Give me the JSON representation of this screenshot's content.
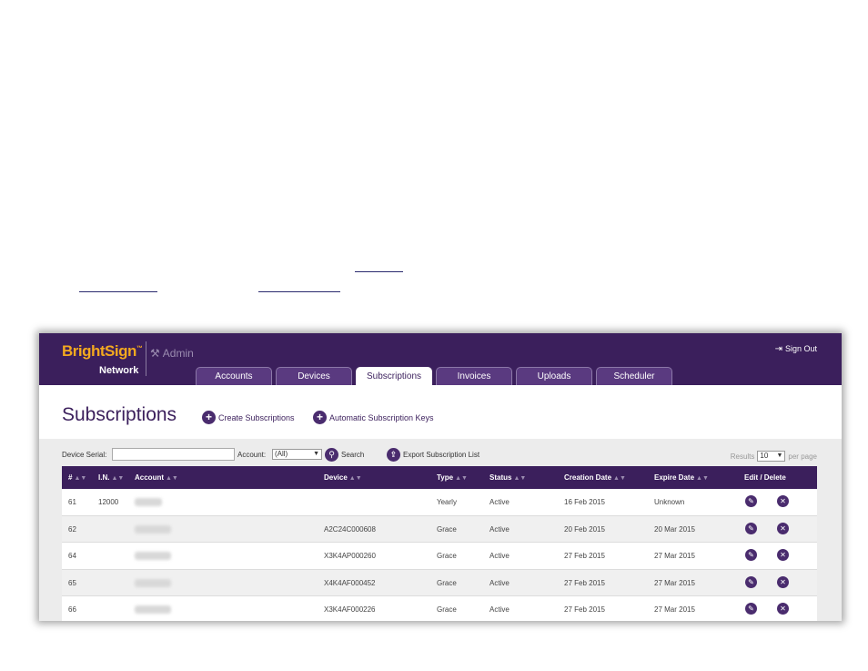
{
  "header": {
    "brand": "BrightSign",
    "brand_sub": "Network",
    "admin_label": "Admin",
    "signout_label": "Sign Out",
    "tabs": [
      {
        "label": "Accounts",
        "active": false
      },
      {
        "label": "Devices",
        "active": false
      },
      {
        "label": "Subscriptions",
        "active": true
      },
      {
        "label": "Invoices",
        "active": false
      },
      {
        "label": "Uploads",
        "active": false
      },
      {
        "label": "Scheduler",
        "active": false
      }
    ]
  },
  "page": {
    "title": "Subscriptions",
    "create_label": "Create Subscriptions",
    "auto_keys_label": "Automatic Subscription Keys"
  },
  "filter": {
    "device_serial_label": "Device Serial:",
    "device_serial_value": "",
    "account_label": "Account:",
    "account_value": "(All)",
    "search_label": "Search",
    "export_label": "Export Subscription List",
    "results_label": "Results",
    "results_value": "10",
    "per_page_label": "per page"
  },
  "table": {
    "columns": [
      "#",
      "I.N.",
      "Account",
      "Device",
      "Type",
      "Status",
      "Creation Date",
      "Expire Date",
      "Edit / Delete"
    ],
    "rows": [
      {
        "num": "61",
        "in": "12000",
        "device": "",
        "type": "Yearly",
        "status": "Active",
        "created": "16 Feb 2015",
        "expires": "Unknown"
      },
      {
        "num": "62",
        "in": "",
        "device": "A2C24C000608",
        "type": "Grace",
        "status": "Active",
        "created": "20 Feb 2015",
        "expires": "20 Mar 2015"
      },
      {
        "num": "64",
        "in": "",
        "device": "X3K4AP000260",
        "type": "Grace",
        "status": "Active",
        "created": "27 Feb 2015",
        "expires": "27 Mar 2015"
      },
      {
        "num": "65",
        "in": "",
        "device": "X4K4AF000452",
        "type": "Grace",
        "status": "Active",
        "created": "27 Feb 2015",
        "expires": "27 Mar 2015"
      },
      {
        "num": "66",
        "in": "",
        "device": "X3K4AF000226",
        "type": "Grace",
        "status": "Active",
        "created": "27 Feb 2015",
        "expires": "27 Mar 2015"
      }
    ]
  },
  "icons": {
    "edit": "pencil-icon",
    "delete": "close-icon",
    "add": "plus-icon",
    "search": "search-icon",
    "export": "export-icon",
    "signout": "signout-icon",
    "admin": "tools-icon"
  },
  "colors": {
    "primary": "#3b1f5c",
    "brand": "#f3a91f"
  }
}
